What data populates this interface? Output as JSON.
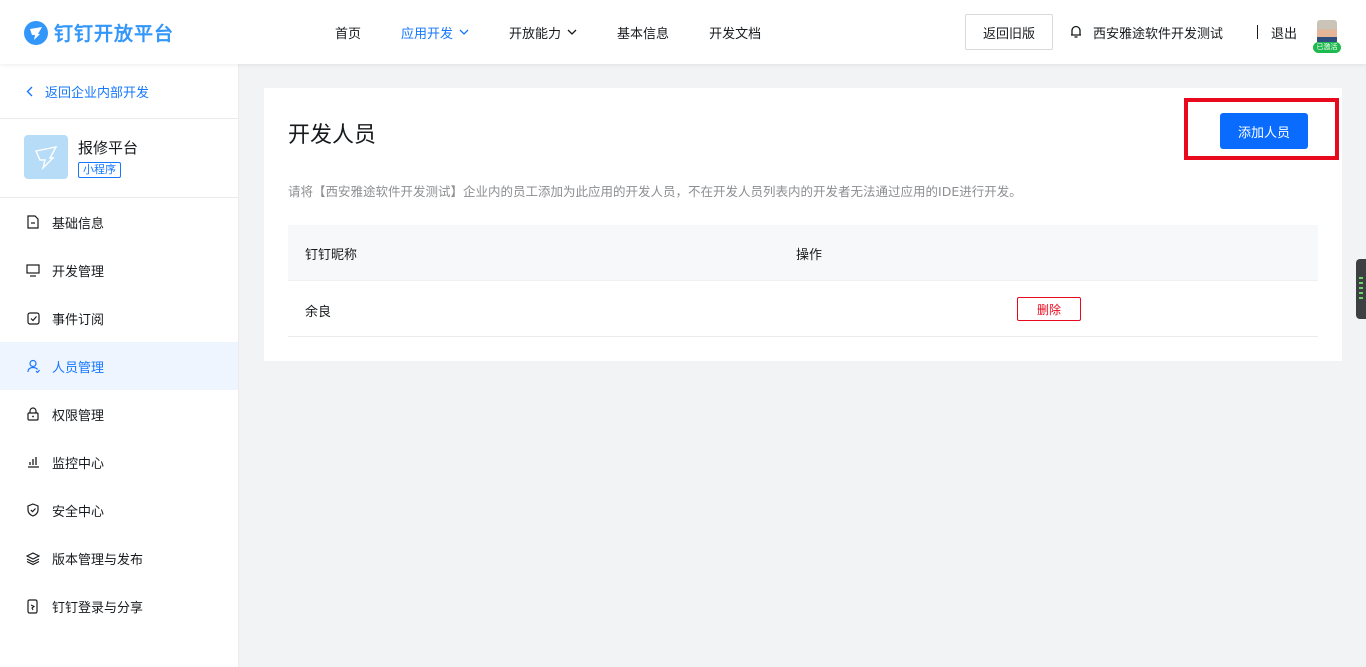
{
  "header": {
    "logo_text": "钉钉开放平台",
    "nav": [
      {
        "label": "首页"
      },
      {
        "label": "应用开发"
      },
      {
        "label": "开放能力"
      },
      {
        "label": "基本信息"
      },
      {
        "label": "开发文档"
      }
    ],
    "old_version_label": "返回旧版",
    "org_name": "西安雅途软件开发测试",
    "logout_label": "退出",
    "avatar_badge": "已激活"
  },
  "sidebar": {
    "back_label": "返回企业内部开发",
    "app_name": "报修平台",
    "app_tag": "小程序",
    "items": [
      {
        "label": "基础信息",
        "icon": "file-icon"
      },
      {
        "label": "开发管理",
        "icon": "monitor-icon"
      },
      {
        "label": "事件订阅",
        "icon": "check-box-icon"
      },
      {
        "label": "人员管理",
        "icon": "user-icon"
      },
      {
        "label": "权限管理",
        "icon": "lock-icon"
      },
      {
        "label": "监控中心",
        "icon": "bar-chart-icon"
      },
      {
        "label": "安全中心",
        "icon": "shield-icon"
      },
      {
        "label": "版本管理与发布",
        "icon": "layers-icon"
      },
      {
        "label": "钉钉登录与分享",
        "icon": "phone-login-icon"
      }
    ],
    "active_index": 3
  },
  "main": {
    "title": "开发人员",
    "add_button_label": "添加人员",
    "description": "请将【西安雅途软件开发测试】企业内的员工添加为此应用的开发人员，不在开发人员列表内的开发者无法通过应用的IDE进行开发。",
    "table": {
      "columns": [
        "钉钉昵称",
        "操作"
      ],
      "rows": [
        {
          "nickname": "余良",
          "action_label": "删除"
        }
      ]
    }
  },
  "colors": {
    "brand": "#3296fa",
    "primary": "#0a6cff",
    "danger": "#e8091c",
    "active_bg": "#eef5ff"
  }
}
